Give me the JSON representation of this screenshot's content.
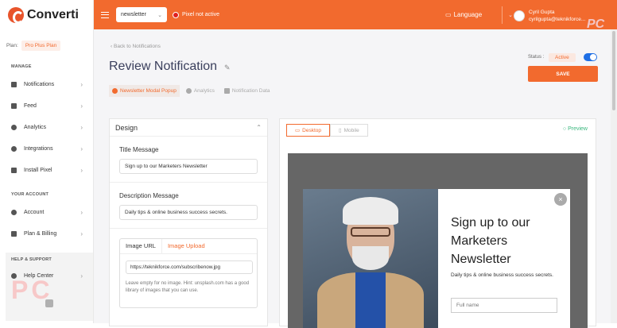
{
  "app": {
    "logo_text": "Converti"
  },
  "sidebar": {
    "plan_label": "Plan:",
    "plan_value": "Pro Plus Plan",
    "manage_title": "MANAGE",
    "items": [
      {
        "label": "Notifications",
        "icon": "bell-icon"
      },
      {
        "label": "Feed",
        "icon": "feed-icon"
      },
      {
        "label": "Analytics",
        "icon": "pie-chart-icon"
      },
      {
        "label": "Integrations",
        "icon": "puzzle-icon"
      },
      {
        "label": "Install Pixel",
        "icon": "code-icon"
      }
    ],
    "account_title": "YOUR ACCOUNT",
    "account_items": [
      {
        "label": "Account",
        "icon": "user-icon"
      },
      {
        "label": "Plan & Billing",
        "icon": "billing-icon"
      }
    ],
    "help_title": "HELP & SUPPORT",
    "help_item": "Help Center",
    "watermark": "PC"
  },
  "topbar": {
    "campaign_select": "newsletter",
    "pixel_status": "Pixel not active",
    "language": "Language",
    "user_name": "Cyril Gupta",
    "user_email": "cyrilgupta@teknikforce...",
    "watermark": "PC"
  },
  "page": {
    "back_link": "Back to Notifications",
    "title": "Review Notification",
    "status_label": "Status :",
    "status_value": "Active",
    "save_label": "SAVE",
    "tabs": [
      {
        "label": "Newsletter Modal Popup"
      },
      {
        "label": "Analytics"
      },
      {
        "label": "Notification Data"
      }
    ]
  },
  "design": {
    "header": "Design",
    "title_label": "Title Message",
    "title_value": "Sign up to our Marketers Newsletter",
    "desc_label": "Description Message",
    "desc_value": "Daily tips & online business success secrets.",
    "image_tab_url": "Image URL",
    "image_tab_upload": "Image Upload",
    "image_url": "https://teknikforce.com/subscribenow.jpg",
    "hint": "Leave empty for no image. Hint: unsplash.com has a good library of images that you can use."
  },
  "preview": {
    "desktop_label": "Desktop",
    "mobile_label": "Mobile",
    "preview_label": "Preview",
    "modal_title": "Sign up to our Marketers Newsletter",
    "modal_sub": "Daily tips & online business success secrets.",
    "field_placeholder": "Full name",
    "close_glyph": "×"
  }
}
